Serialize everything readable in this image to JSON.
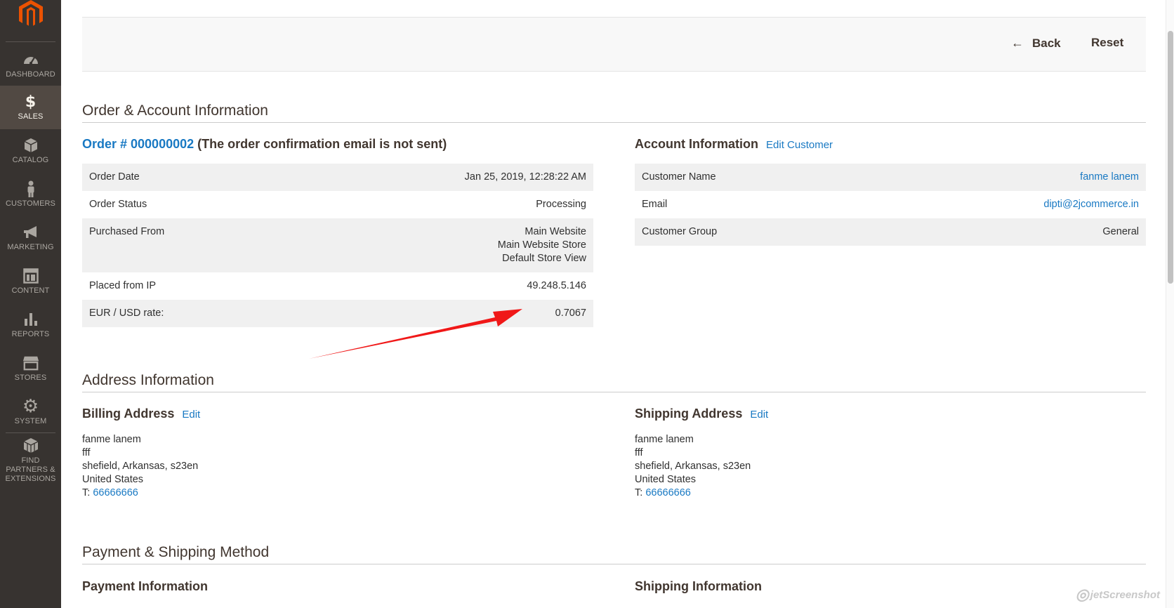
{
  "sidebar": {
    "items": [
      {
        "label": "DASHBOARD",
        "icon": "dashboard-icon"
      },
      {
        "label": "SALES",
        "icon": "dollar-icon"
      },
      {
        "label": "CATALOG",
        "icon": "box-icon"
      },
      {
        "label": "CUSTOMERS",
        "icon": "person-icon"
      },
      {
        "label": "MARKETING",
        "icon": "megaphone-icon"
      },
      {
        "label": "CONTENT",
        "icon": "layout-icon"
      },
      {
        "label": "REPORTS",
        "icon": "bar-chart-icon"
      },
      {
        "label": "STORES",
        "icon": "store-icon"
      },
      {
        "label": "SYSTEM",
        "icon": "gear-icon"
      },
      {
        "label": "FIND PARTNERS & EXTENSIONS",
        "icon": "cubes-icon"
      }
    ],
    "active": "SALES"
  },
  "actions": {
    "back_label": "Back",
    "reset_label": "Reset"
  },
  "order_section": {
    "title": "Order & Account Information",
    "order_link": "Order # 000000002",
    "order_note": "(The order confirmation email is not sent)",
    "rows": [
      {
        "label": "Order Date",
        "value": "Jan 25, 2019, 12:28:22 AM"
      },
      {
        "label": "Order Status",
        "value": "Processing"
      },
      {
        "label": "Purchased From",
        "value_lines": [
          "Main Website",
          "Main Website Store",
          "Default Store View"
        ]
      },
      {
        "label": "Placed from IP",
        "value": "49.248.5.146"
      },
      {
        "label": "EUR / USD rate:",
        "value": "0.7067"
      }
    ]
  },
  "account_section": {
    "title": "Account Information",
    "edit_link": "Edit Customer",
    "rows": [
      {
        "label": "Customer Name",
        "value": "fanme lanem"
      },
      {
        "label": "Email",
        "value": "dipti@2jcommerce.in"
      },
      {
        "label": "Customer Group",
        "value": "General"
      }
    ]
  },
  "address_section": {
    "title": "Address Information",
    "billing": {
      "title": "Billing Address",
      "edit": "Edit",
      "name": "fanme lanem",
      "line2": "fff",
      "city_line": "shefield, Arkansas, s23en",
      "country": "United States",
      "phone_prefix": "T: ",
      "phone": "66666666"
    },
    "shipping": {
      "title": "Shipping Address",
      "edit": "Edit",
      "name": "fanme lanem",
      "line2": "fff",
      "city_line": "shefield, Arkansas, s23en",
      "country": "United States",
      "phone_prefix": "T: ",
      "phone": "66666666"
    }
  },
  "payment_section": {
    "title": "Payment & Shipping Method",
    "payment_title": "Payment Information",
    "shipping_title": "Shipping Information"
  },
  "colors": {
    "sidebar_bg": "#373330",
    "sidebar_active": "#514943",
    "link": "#1979c3",
    "logo": "#eb5202",
    "annotation_arrow": "#f01818"
  },
  "watermark": "jetScreenshot"
}
